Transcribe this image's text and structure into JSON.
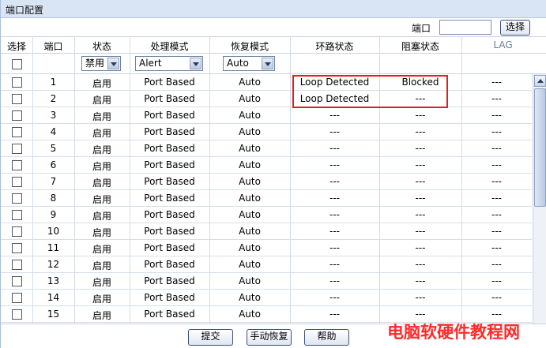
{
  "panel": {
    "title": "端口配置"
  },
  "port_search": {
    "label": "端口",
    "value": "",
    "button": "选择"
  },
  "columns": [
    "选择",
    "端口",
    "状态",
    "处理模式",
    "恢复模式",
    "环路状态",
    "阻塞状态",
    "LAG"
  ],
  "filters": {
    "status": "禁用",
    "process_mode": "Alert",
    "recovery_mode": "Auto"
  },
  "rows": [
    {
      "port": "1",
      "status": "启用",
      "mode": "Port Based",
      "recovery": "Auto",
      "loop": "Loop Detected",
      "block": "Blocked",
      "lag": "---"
    },
    {
      "port": "2",
      "status": "启用",
      "mode": "Port Based",
      "recovery": "Auto",
      "loop": "Loop Detected",
      "block": "---",
      "lag": "---"
    },
    {
      "port": "3",
      "status": "启用",
      "mode": "Port Based",
      "recovery": "Auto",
      "loop": "---",
      "block": "---",
      "lag": "---"
    },
    {
      "port": "4",
      "status": "启用",
      "mode": "Port Based",
      "recovery": "Auto",
      "loop": "---",
      "block": "---",
      "lag": "---"
    },
    {
      "port": "5",
      "status": "启用",
      "mode": "Port Based",
      "recovery": "Auto",
      "loop": "---",
      "block": "---",
      "lag": "---"
    },
    {
      "port": "6",
      "status": "启用",
      "mode": "Port Based",
      "recovery": "Auto",
      "loop": "---",
      "block": "---",
      "lag": "---"
    },
    {
      "port": "7",
      "status": "启用",
      "mode": "Port Based",
      "recovery": "Auto",
      "loop": "---",
      "block": "---",
      "lag": "---"
    },
    {
      "port": "8",
      "status": "启用",
      "mode": "Port Based",
      "recovery": "Auto",
      "loop": "---",
      "block": "---",
      "lag": "---"
    },
    {
      "port": "9",
      "status": "启用",
      "mode": "Port Based",
      "recovery": "Auto",
      "loop": "---",
      "block": "---",
      "lag": "---"
    },
    {
      "port": "10",
      "status": "启用",
      "mode": "Port Based",
      "recovery": "Auto",
      "loop": "---",
      "block": "---",
      "lag": "---"
    },
    {
      "port": "11",
      "status": "启用",
      "mode": "Port Based",
      "recovery": "Auto",
      "loop": "---",
      "block": "---",
      "lag": "---"
    },
    {
      "port": "12",
      "status": "启用",
      "mode": "Port Based",
      "recovery": "Auto",
      "loop": "---",
      "block": "---",
      "lag": "---"
    },
    {
      "port": "13",
      "status": "启用",
      "mode": "Port Based",
      "recovery": "Auto",
      "loop": "---",
      "block": "---",
      "lag": "---"
    },
    {
      "port": "14",
      "status": "启用",
      "mode": "Port Based",
      "recovery": "Auto",
      "loop": "---",
      "block": "---",
      "lag": "---"
    },
    {
      "port": "15",
      "status": "启用",
      "mode": "Port Based",
      "recovery": "Auto",
      "loop": "---",
      "block": "---",
      "lag": "---"
    }
  ],
  "buttons": {
    "submit": "提交",
    "manual_recover": "手动恢复",
    "help": "帮助"
  },
  "watermark": "电脑软硬件教程网",
  "colors": {
    "title_bar": "#d9e4f5",
    "highlight": "#e02020",
    "watermark": "#ff2a2a"
  }
}
